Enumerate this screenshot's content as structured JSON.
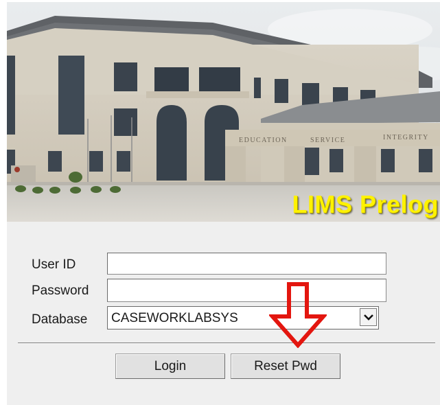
{
  "banner": {
    "title": "LIMS Prelog",
    "title_color": "#fff200",
    "signs": [
      "EDUCATION",
      "SERVICE",
      "INTEGRITY"
    ]
  },
  "form": {
    "user_id": {
      "label": "User ID",
      "value": ""
    },
    "password": {
      "label": "Password",
      "value": ""
    },
    "database": {
      "label": "Database",
      "selected": "CASEWORKLABSYS",
      "icon": "chevron-down-icon"
    }
  },
  "buttons": {
    "login_label": "Login",
    "reset_label": "Reset Pwd"
  },
  "annotation": {
    "icon": "down-arrow-icon",
    "color": "#e3160f"
  }
}
